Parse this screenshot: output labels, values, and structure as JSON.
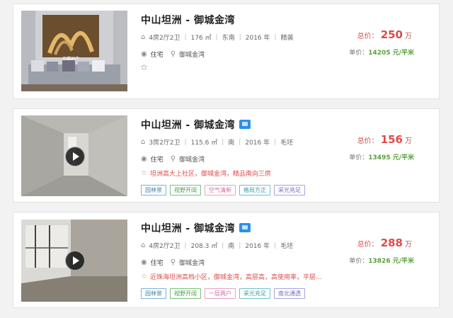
{
  "listings": [
    {
      "title": "中山坦洲 - 御城金湾",
      "layout": "4房2厅2卫",
      "area": "176 ㎡",
      "facing": "东南",
      "year": "2016 年",
      "decoration": "精装",
      "type": "住宅",
      "community": "御城金湾",
      "highlight": "",
      "price_label": "总价：",
      "price_value": "250",
      "price_unit": "万",
      "unit_label": "单价：",
      "unit_value": "14205 元/平米",
      "tags": [],
      "watermark": "正耀地产"
    },
    {
      "title": "中山坦洲 - 御城金湾",
      "layout": "3房2厅2卫",
      "area": "115.6 ㎡",
      "facing": "南",
      "year": "2016 年",
      "decoration": "毛坯",
      "type": "住宅",
      "community": "御城金湾",
      "highlight": "坦洲高大上社区，御城金湾，精品南向三房",
      "price_label": "总价：",
      "price_value": "156",
      "price_unit": "万",
      "unit_label": "单价：",
      "unit_value": "13495 元/平米",
      "tags": [
        "园林景",
        "视野开阔",
        "空气清新",
        "格局方正",
        "采光充足"
      ]
    },
    {
      "title": "中山坦洲 - 御城金湾",
      "layout": "4房2厅2卫",
      "area": "208.3 ㎡",
      "facing": "南",
      "year": "2016 年",
      "decoration": "毛坯",
      "type": "住宅",
      "community": "御城金湾",
      "highlight": "近珠海坦洲高档小区，御城金湾，高层高，高使用率，平层...",
      "price_label": "总价：",
      "price_value": "288",
      "price_unit": "万",
      "unit_label": "单价：",
      "unit_value": "13826 元/平米",
      "tags": [
        "园林景",
        "视野开阔",
        "一层两户",
        "采光充足",
        "南北通透"
      ]
    }
  ],
  "colors": {
    "price": "#e04a4a",
    "unit_price": "#5aa03d",
    "highlight": "#e04a4a"
  },
  "icons": {
    "layout": "home-icon",
    "type": "building-icon",
    "location": "map-pin-icon",
    "favorite": "star-outline-icon",
    "video": "play-icon",
    "vr": "vr-badge-icon"
  }
}
